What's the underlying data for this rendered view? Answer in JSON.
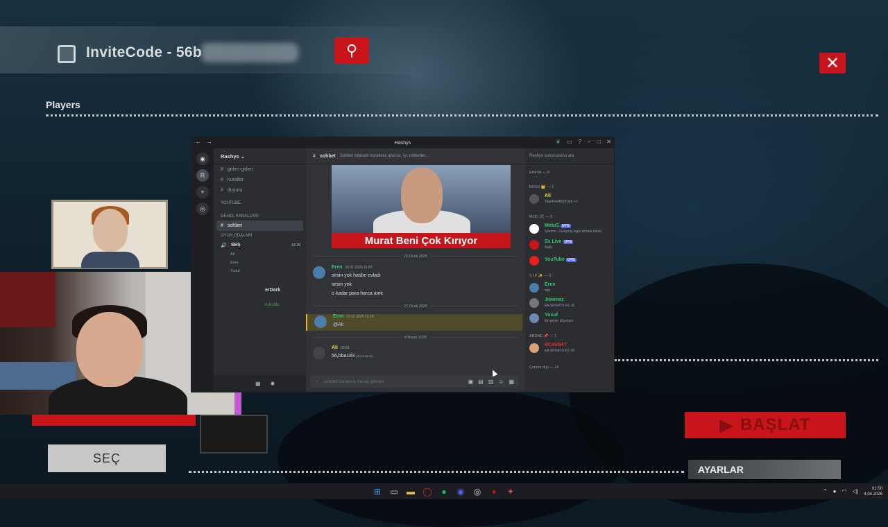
{
  "game": {
    "invite_code": "InviteCode - 56b",
    "players_label": "Players",
    "sec_button": "SEÇ",
    "baslat_button": "BAŞLAT",
    "ayarlar_button": "AYARLAR",
    "accent_red": "#c8151b",
    "search_icon": "search-icon",
    "close_icon": "close-icon"
  },
  "discord": {
    "window_title": "Rashys",
    "server_name": "Rashys",
    "channels": [
      {
        "icon": "#",
        "label": "gelen-giden"
      },
      {
        "icon": "#",
        "label": "kurallar"
      },
      {
        "icon": "#",
        "label": "duyuru"
      }
    ],
    "categories": [
      "YOUTUBE",
      "GENEL KANALLARI",
      "OYUN ODALARI"
    ],
    "active_channel": "sohbet",
    "voice_label": "SES",
    "voice_users": [
      "Ali",
      "Eren",
      "Yusuf"
    ],
    "voice_counts": [
      "03",
      "20"
    ],
    "partial_text": "erDark",
    "partial_text2": "Kuruldu",
    "topic": "Sohbet odasıdır kurallara uyunuz, iyi sohbetler...",
    "meme_caption": "Murat Beni Çok Kırıyor",
    "dates": [
      "20 Ocak 2026",
      "27 Ocak 2026",
      "4 Nisan 2026"
    ],
    "messages": [
      {
        "author": "Eren",
        "time": "20.01.2026 16:56",
        "lines": [
          "sesin yok hasbe evladı",
          "sesin yok",
          "o kadar para harca amk"
        ]
      },
      {
        "author": "Eren",
        "time": "27.01.2026 19:18",
        "lines": [
          "@Ali"
        ]
      },
      {
        "author": "Ali",
        "time": "00:09",
        "lines": [
          "56,bba183"
        ],
        "suffix": "(düzenlendi)"
      }
    ],
    "composer_placeholder": "sohbet kanalına mesaj gönder",
    "member_search": "Rashys sunucusunu ara",
    "activity_label": "Etkinlik — 8",
    "groups": [
      {
        "label": "BOSS 👑 — 1",
        "members": [
          {
            "name": "Ali",
            "status": "TogetherAfterDark +2",
            "color": "#f0e040"
          }
        ]
      },
      {
        "label": "MOD 🛠 — 3",
        "members": [
          {
            "name": "MetuS",
            "status": "/yardım - Gelişmiş loglu destek talebi",
            "color": "#2ecc71",
            "badge": "UYG"
          },
          {
            "name": "Sx Live",
            "status": "/help",
            "color": "#2ecc71",
            "badge": "UYG"
          },
          {
            "name": "YouTube",
            "status": "",
            "color": "#2ecc71",
            "badge": "UYG"
          }
        ]
      },
      {
        "label": "V.I.P ✨ — 3",
        "members": [
          {
            "name": "Eren",
            "status": "aşq",
            "color": "#2ecc71"
          },
          {
            "name": "Jimenez",
            "status": "EA SPORTS FC 26",
            "color": "#2ecc71"
          },
          {
            "name": "Yusuf",
            "status": "bir şeyler izliyorum",
            "color": "#2ecc71"
          }
        ]
      },
      {
        "label": "ABONE 📌 — 1",
        "members": [
          {
            "name": "RC4SN4T",
            "status": "EA SPORTS FC 26",
            "color": "#e03030"
          }
        ]
      }
    ],
    "offline_label": "Çevrim dışı — 24"
  },
  "taskbar": {
    "time": "01:00",
    "date": "4.04.2026",
    "icons": [
      "windows-start-icon",
      "search-icon",
      "file-explorer-icon",
      "opera-icon",
      "spotify-icon",
      "discord-icon",
      "chrome-icon",
      "app-icon",
      "game-icon"
    ]
  }
}
